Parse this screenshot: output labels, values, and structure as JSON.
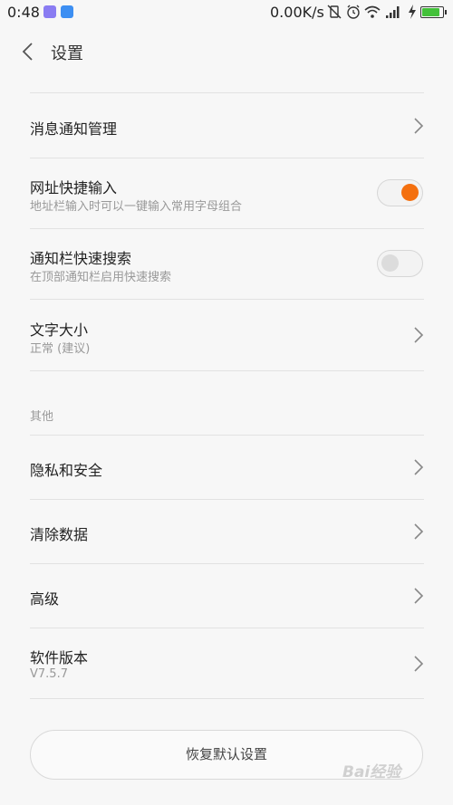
{
  "status_bar": {
    "time": "0:48",
    "speed": "0.00K/s",
    "icons": [
      "notification-app-icon",
      "message-app-icon",
      "vibrate-off-icon",
      "alarm-icon",
      "wifi-icon",
      "signal-icon",
      "charging-icon",
      "battery-icon"
    ],
    "battery_level_fraction": 0.9
  },
  "header": {
    "title": "设置"
  },
  "items": [
    {
      "title": "消息通知管理",
      "type": "link"
    },
    {
      "title": "网址快捷输入",
      "subtitle": "地址栏输入时可以一键输入常用字母组合",
      "type": "toggle",
      "on": true
    },
    {
      "title": "通知栏快速搜索",
      "subtitle": "在顶部通知栏启用快速搜索",
      "type": "toggle",
      "on": false
    },
    {
      "title": "文字大小",
      "subtitle": "正常 (建议)",
      "type": "link"
    }
  ],
  "section_other": {
    "label": "其他",
    "items": [
      {
        "title": "隐私和安全"
      },
      {
        "title": "清除数据"
      },
      {
        "title": "高级"
      },
      {
        "title": "软件版本",
        "subtitle": "V7.5.7"
      }
    ]
  },
  "reset_button": "恢复默认设置",
  "watermark": "Bai经验",
  "colors": {
    "accent": "#f4700f",
    "background": "#f7f7f7",
    "battery": "#43c13a"
  }
}
